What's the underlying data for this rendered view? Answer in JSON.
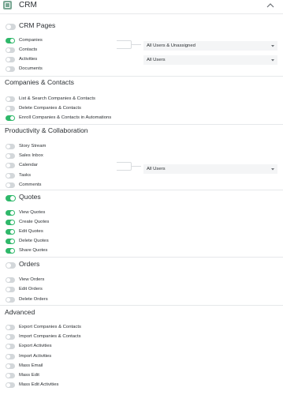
{
  "header": {
    "title": "CRM",
    "icon": "crm-app-icon",
    "collapse_icon": "chevron-up-icon"
  },
  "sections": {
    "crm_pages": {
      "title": "CRM Pages",
      "enabled": false
    },
    "companies_contacts": {
      "title": "Companies & Contacts"
    },
    "productivity": {
      "title": "Productivity & Collaboration"
    },
    "quotes": {
      "title": "Quotes",
      "enabled": true
    },
    "orders": {
      "title": "Orders",
      "enabled": false
    },
    "advanced": {
      "title": "Advanced"
    }
  },
  "crm_pages": [
    {
      "label": "Companies",
      "enabled": true
    },
    {
      "label": "Contacts",
      "enabled": false
    },
    {
      "label": "Activities",
      "enabled": false
    },
    {
      "label": "Documents",
      "enabled": false
    }
  ],
  "crm_pages_selects": [
    {
      "value": "All Users & Unassigned"
    },
    {
      "value": "All Users"
    }
  ],
  "companies_contacts": [
    {
      "label": "List & Search Companies & Contacts",
      "enabled": false
    },
    {
      "label": "Delete Companies & Contacts",
      "enabled": false
    },
    {
      "label": "Enroll Companies & Contacts in Automations",
      "enabled": true
    }
  ],
  "productivity": [
    {
      "label": "Story Stream",
      "enabled": false
    },
    {
      "label": "Sales Inbox",
      "enabled": false
    },
    {
      "label": "Calendar",
      "enabled": false
    },
    {
      "label": "Tasks",
      "enabled": false
    },
    {
      "label": "Comments",
      "enabled": false
    }
  ],
  "productivity_select": {
    "value": "All Users"
  },
  "quotes": [
    {
      "label": "View Quotes",
      "enabled": true
    },
    {
      "label": "Create Quotes",
      "enabled": true
    },
    {
      "label": "Edit Quotes",
      "enabled": true
    },
    {
      "label": "Delete Quotes",
      "enabled": true
    },
    {
      "label": "Share Quotes",
      "enabled": true
    }
  ],
  "orders": [
    {
      "label": "View Orders",
      "enabled": false
    },
    {
      "label": "Edit Orders",
      "enabled": false
    },
    {
      "label": "Delete Orders",
      "enabled": false
    }
  ],
  "advanced": [
    {
      "label": "Export Companies & Contacts",
      "enabled": false
    },
    {
      "label": "Import Companies & Contacts",
      "enabled": false
    },
    {
      "label": "Export Activities",
      "enabled": false
    },
    {
      "label": "Import Activities",
      "enabled": false
    },
    {
      "label": "Mass Email",
      "enabled": false
    },
    {
      "label": "Mass Edit",
      "enabled": false
    },
    {
      "label": "Mass Edit Activities",
      "enabled": false
    }
  ],
  "colors": {
    "toggle_on": "#2fb86a",
    "toggle_off": "#d3d7da",
    "brand_icon": "#7aa894"
  }
}
